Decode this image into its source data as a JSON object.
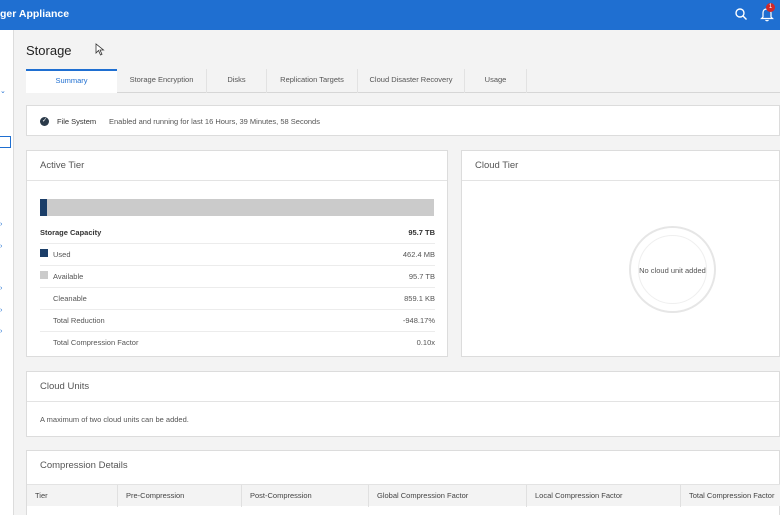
{
  "app": {
    "title": "ger Appliance",
    "notification_count": "1"
  },
  "page": {
    "title": "Storage"
  },
  "tabs": [
    "Summary",
    "Storage Encryption",
    "Disks",
    "Replication Targets",
    "Cloud Disaster Recovery",
    "Usage"
  ],
  "file_system": {
    "label": "File System",
    "status": "Enabled and running for last 16 Hours, 39 Minutes, 58 Seconds"
  },
  "active_tier": {
    "title": "Active Tier",
    "used_fraction": 0.017,
    "capacity_label": "Storage Capacity",
    "capacity_value": "95.7 TB",
    "rows": [
      {
        "label": "Used",
        "value": "462.4 MB",
        "swatch": "#1b3e68"
      },
      {
        "label": "Available",
        "value": "95.7 TB",
        "swatch": "#cbcbcb"
      },
      {
        "label": "Cleanable",
        "value": "859.1 KB"
      },
      {
        "label": "Total Reduction",
        "value": "-948.17%"
      },
      {
        "label": "Total Compression Factor",
        "value": "0.10x"
      }
    ]
  },
  "cloud_tier": {
    "title": "Cloud Tier",
    "empty_text": "No cloud unit added"
  },
  "cloud_units": {
    "title": "Cloud Units",
    "text": "A maximum of two cloud units can be added."
  },
  "compression_details": {
    "title": "Compression Details",
    "columns": [
      "Tier",
      "Pre-Compression",
      "Post-Compression",
      "Global Compression Factor",
      "Local Compression Factor",
      "Total Compression Factor"
    ]
  },
  "colors": {
    "accent": "#1f6fd1",
    "used": "#1b3e68",
    "available": "#cbcbcb"
  }
}
